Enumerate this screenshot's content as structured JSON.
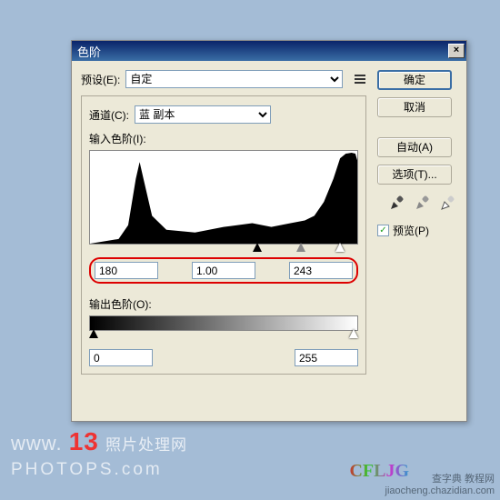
{
  "dialog": {
    "title": "色阶",
    "preset_label": "预设(E):",
    "preset_value": "自定",
    "channel_label": "通道(C):",
    "channel_value": "蓝 副本",
    "input_levels_label": "输入色阶(I):",
    "input_shadow": "180",
    "input_mid": "1.00",
    "input_highlight": "243",
    "output_levels_label": "输出色阶(O):",
    "output_shadow": "0",
    "output_highlight": "255"
  },
  "buttons": {
    "ok": "确定",
    "cancel": "取消",
    "auto": "自动(A)",
    "options": "选项(T)..."
  },
  "preview": {
    "checked": "✓",
    "label": "预览(P)"
  },
  "watermark": {
    "site": "www.",
    "num": "13",
    "cn": "照片处理网",
    "domain": "PHOTOPS.com",
    "logo2": "CFLJG"
  },
  "footer": {
    "line1": "查字典  教程网",
    "line2": "jiaocheng.chazidian.com"
  }
}
